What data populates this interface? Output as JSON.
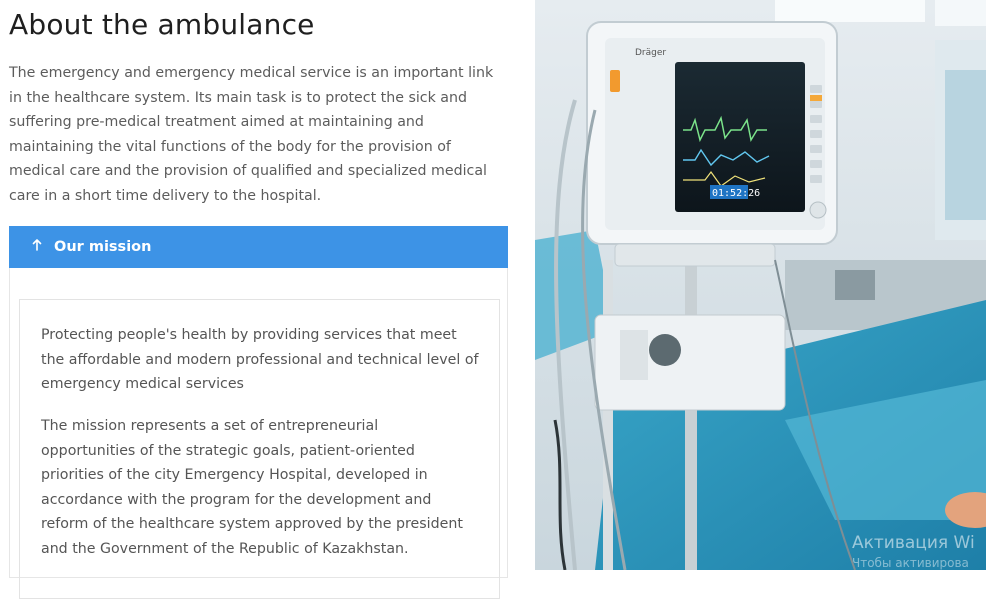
{
  "page": {
    "title": "About the ambulance",
    "intro": "The emergency and emergency medical service is an important link in the healthcare system. Its main task is to protect the sick and suffering pre-medical treatment aimed at maintaining and maintaining the vital functions of the body for the provision of medical care and the provision of qualified and specialized medical care in a short time delivery to the hospital."
  },
  "accordion": {
    "header_label": "Our mission",
    "header_icon": "arrow-up-icon",
    "expanded": true,
    "paragraphs": [
      "Protecting people's health by providing services that meet the affordable and modern professional and technical level of emergency medical services",
      "The mission represents a set of entrepreneurial opportunities of the strategic goals, patient-oriented priorities of the city Emergency Hospital, developed in accordance with the program for the development and reform of the healthcare system approved by the president and the Government of the Republic of Kazakhstan."
    ]
  },
  "image": {
    "monitor_time": "01:52:26",
    "monitor_brand": "Dräger"
  },
  "watermark": {
    "line1": "Активация Wi",
    "line2": "Чтобы активирова"
  },
  "colors": {
    "accent": "#3d93e6",
    "title": "#1f1f1f",
    "body_text": "#5c5c5c"
  }
}
